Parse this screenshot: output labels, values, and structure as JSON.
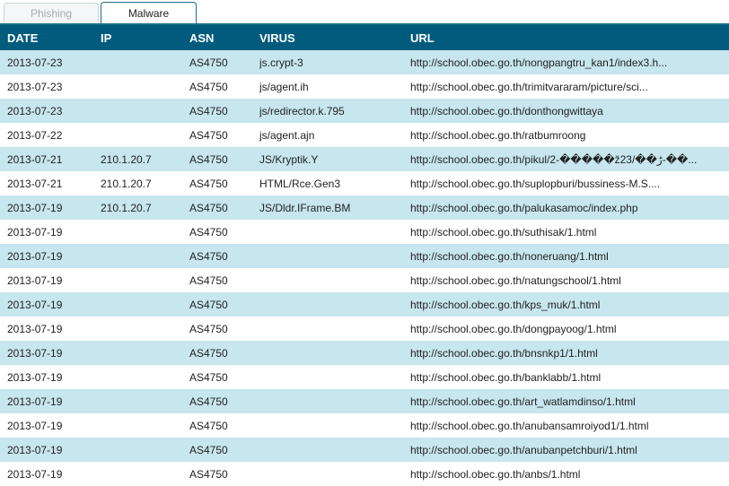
{
  "tabs": [
    {
      "label": "Phishing",
      "active": false
    },
    {
      "label": "Malware",
      "active": true
    }
  ],
  "table": {
    "headers": {
      "date": "DATE",
      "ip": "IP",
      "asn": "ASN",
      "virus": "VIRUS",
      "url": "URL"
    },
    "rows": [
      {
        "date": "2013-07-23",
        "ip": "",
        "asn": "AS4750",
        "virus": "js.crypt-3",
        "url": "http://school.obec.go.th/nongpangtru_kan1/index3.h..."
      },
      {
        "date": "2013-07-23",
        "ip": "",
        "asn": "AS4750",
        "virus": "js/agent.ih",
        "url": "http://school.obec.go.th/trimitvararam/picture/sci..."
      },
      {
        "date": "2013-07-23",
        "ip": "",
        "asn": "AS4750",
        "virus": "js/redirector.k.795",
        "url": "http://school.obec.go.th/donthongwittaya"
      },
      {
        "date": "2013-07-22",
        "ip": "",
        "asn": "AS4750",
        "virus": "js/agent.ajn",
        "url": "http://school.obec.go.th/ratbumroong"
      },
      {
        "date": "2013-07-21",
        "ip": "210.1.20.7",
        "asn": "AS4750",
        "virus": "JS/Kryptik.Y",
        "url": "http://school.obec.go.th/pikul/2-�����ž23/��ڑ-��..."
      },
      {
        "date": "2013-07-21",
        "ip": "210.1.20.7",
        "asn": "AS4750",
        "virus": "HTML/Rce.Gen3",
        "url": "http://school.obec.go.th/suplopburi/bussiness-M.S...."
      },
      {
        "date": "2013-07-19",
        "ip": "210.1.20.7",
        "asn": "AS4750",
        "virus": "JS/Dldr.IFrame.BM",
        "url": "http://school.obec.go.th/palukasamoc/index.php"
      },
      {
        "date": "2013-07-19",
        "ip": "",
        "asn": "AS4750",
        "virus": "",
        "url": "http://school.obec.go.th/suthisak/1.html"
      },
      {
        "date": "2013-07-19",
        "ip": "",
        "asn": "AS4750",
        "virus": "",
        "url": "http://school.obec.go.th/noneruang/1.html"
      },
      {
        "date": "2013-07-19",
        "ip": "",
        "asn": "AS4750",
        "virus": "",
        "url": "http://school.obec.go.th/natungschool/1.html"
      },
      {
        "date": "2013-07-19",
        "ip": "",
        "asn": "AS4750",
        "virus": "",
        "url": "http://school.obec.go.th/kps_muk/1.html"
      },
      {
        "date": "2013-07-19",
        "ip": "",
        "asn": "AS4750",
        "virus": "",
        "url": "http://school.obec.go.th/dongpayoog/1.html"
      },
      {
        "date": "2013-07-19",
        "ip": "",
        "asn": "AS4750",
        "virus": "",
        "url": "http://school.obec.go.th/bnsnkp1/1.html"
      },
      {
        "date": "2013-07-19",
        "ip": "",
        "asn": "AS4750",
        "virus": "",
        "url": "http://school.obec.go.th/banklabb/1.html"
      },
      {
        "date": "2013-07-19",
        "ip": "",
        "asn": "AS4750",
        "virus": "",
        "url": "http://school.obec.go.th/art_watlamdinso/1.html"
      },
      {
        "date": "2013-07-19",
        "ip": "",
        "asn": "AS4750",
        "virus": "",
        "url": "http://school.obec.go.th/anubansamroiyod1/1.html"
      },
      {
        "date": "2013-07-19",
        "ip": "",
        "asn": "AS4750",
        "virus": "",
        "url": "http://school.obec.go.th/anubanpetchburi/1.html"
      },
      {
        "date": "2013-07-19",
        "ip": "",
        "asn": "AS4750",
        "virus": "",
        "url": "http://school.obec.go.th/anbs/1.html"
      }
    ]
  },
  "colors": {
    "header_bg": "#005b7c",
    "row_alt_bg": "#c7e6ee",
    "tab_border": "#1b6f8a"
  }
}
